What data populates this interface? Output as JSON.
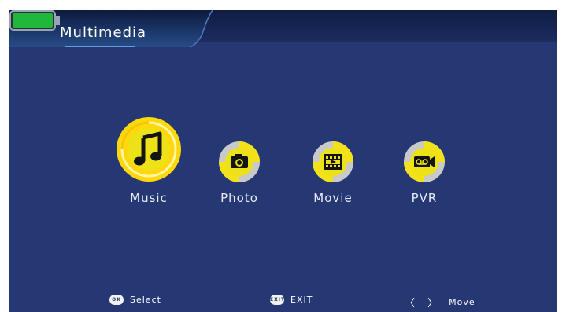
{
  "header": {
    "title": "Multimedia",
    "battery_icon": "battery-full-icon",
    "battery_color": "#1fb73c"
  },
  "menu": {
    "items": [
      {
        "label": "Music",
        "icon": "music-note-icon",
        "selected": true
      },
      {
        "label": "Photo",
        "icon": "camera-icon",
        "selected": false
      },
      {
        "label": "Movie",
        "icon": "film-play-icon",
        "selected": false
      },
      {
        "label": "PVR",
        "icon": "tape-recorder-icon",
        "selected": false
      }
    ]
  },
  "footer": {
    "select_key": "OK",
    "select_label": "Select",
    "exit_key": "EXIT",
    "exit_label": "EXIT",
    "move_arrows": "〈 〉",
    "move_label": "Move"
  },
  "colors": {
    "background": "#263874",
    "accent_yellow": "#f3e11a",
    "icon_ring_gray": "#c9c9c9"
  }
}
